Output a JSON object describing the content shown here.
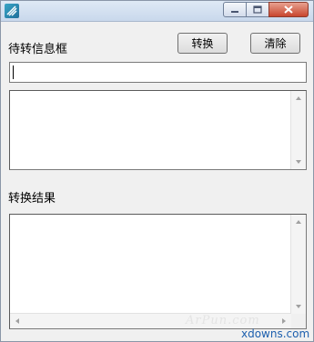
{
  "window": {
    "title": ""
  },
  "controls": {
    "minimize": "minimize",
    "maximize": "maximize",
    "close": "close"
  },
  "input_section": {
    "label": "待转信息框",
    "value": ""
  },
  "buttons": {
    "convert": "转换",
    "clear": "清除"
  },
  "result_section": {
    "label": "转换结果"
  },
  "watermark": {
    "faint": "ArPun.com",
    "site": "xdowns.com"
  },
  "icons": {
    "app": "app-icon",
    "min": "minimize-icon",
    "max": "maximize-icon",
    "close": "close-icon",
    "scroll_up": "scroll-up-arrow-icon",
    "scroll_down": "scroll-down-arrow-icon",
    "scroll_left": "scroll-left-arrow-icon",
    "scroll_right": "scroll-right-arrow-icon"
  },
  "colors": {
    "title_bar": "#c9d8ec",
    "close_button": "#c8462e",
    "watermark_link": "#1d5fae"
  }
}
